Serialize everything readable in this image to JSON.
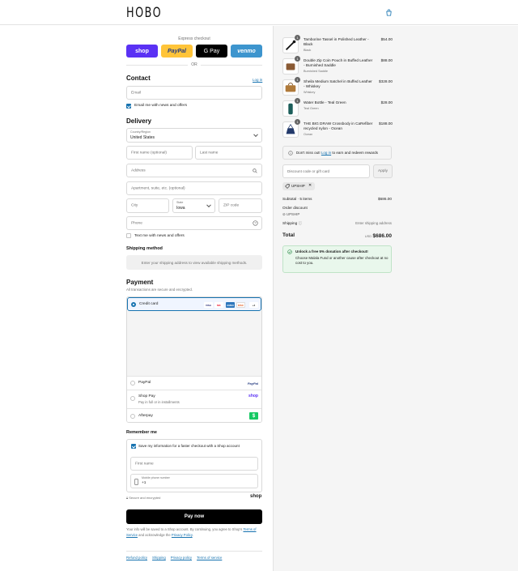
{
  "brand": "HOBO",
  "express": {
    "label": "Express checkout",
    "buttons": [
      "shop",
      "PayPal",
      "G Pay",
      "venmo"
    ],
    "or": "OR"
  },
  "contact": {
    "title": "Contact",
    "login": "Log in",
    "email_placeholder": "Email",
    "news_label": "Email me with news and offers"
  },
  "delivery": {
    "title": "Delivery",
    "country_label": "Country/Region",
    "country_value": "United States",
    "first_name": "First name (optional)",
    "last_name": "Last name",
    "address": "Address",
    "apt": "Apartment, suite, etc. (optional)",
    "city": "City",
    "state_label": "State",
    "state_value": "Iowa",
    "zip": "ZIP code",
    "phone": "Phone",
    "text_news": "Text me with news and offers"
  },
  "shipping": {
    "title": "Shipping method",
    "message": "Enter your shipping address to view available shipping methods."
  },
  "payment": {
    "title": "Payment",
    "subtitle": "All transactions are secure and encrypted.",
    "credit_card": "Credit card",
    "card_logos": [
      "VISA",
      "MC",
      "AMEX",
      "DISC",
      "+4"
    ],
    "paypal": "PayPal",
    "paypal_logo": "PayPal",
    "shop_pay": "Shop Pay",
    "shop_pay_sub": "Pay in full or in installments",
    "shop_logo": "shop",
    "afterpay": "Afterpay"
  },
  "remember": {
    "title": "Remember me",
    "save_label": "Save my information for a faster checkout with a Shop account",
    "first_name": "First name",
    "mobile_label": "Mobile phone number",
    "mobile_value": "+1",
    "secure": "Secure and encrypted",
    "shop": "shop"
  },
  "pay_now": "Pay now",
  "terms": {
    "pre": "Your info will be saved to a Shop account. By continuing, you agree to Shop's",
    "tos": "Terms of Service",
    "mid": "and acknowledge the",
    "privacy": "Privacy Policy",
    "end": "."
  },
  "footer_links": [
    "Refund policy",
    "Shipping",
    "Privacy policy",
    "Terms of service"
  ],
  "cart": {
    "items": [
      {
        "qty": "1",
        "name": "Tamborine Tassel in Polished Leather - Black",
        "variant": "Black",
        "price": "$54.00"
      },
      {
        "qty": "1",
        "name": "Double Zip Coin Pouch in Buffed Leather - Burnished Saddle",
        "variant": "Burnished Saddle",
        "price": "$88.00"
      },
      {
        "qty": "1",
        "name": "Sheila Medium Satchel in Buffed Leather - Whiskey",
        "variant": "Whiskey",
        "price": "$328.00"
      },
      {
        "qty": "1",
        "name": "Water Bottle - Teal Green",
        "variant": "Teal Green",
        "price": "$28.00"
      },
      {
        "qty": "1",
        "name": "THE BIG DRAW Crossbody in CaRefiber recycled nylon - Ocean",
        "variant": "Ocean",
        "price": "$188.00"
      }
    ],
    "reward_pre": "Don't miss out!",
    "reward_link": "Log in",
    "reward_post": "to earn and redeem rewards",
    "discount_placeholder": "Discount code or gift card",
    "apply": "Apply",
    "chip": "UPSHIP",
    "subtotal_label": "Subtotal · 5 items",
    "subtotal_value": "$686.00",
    "order_discount": "Order discount",
    "discount_code": "UPSHIP",
    "shipping_label": "Shipping",
    "shipping_value": "Enter shipping address",
    "total_label": "Total",
    "currency": "USD",
    "total_value": "$686.00",
    "donation_title": "Unlock a free 5% donation after checkout!",
    "donation_text": "Choose Malala Fund or another cause after checkout at no cost to you."
  }
}
